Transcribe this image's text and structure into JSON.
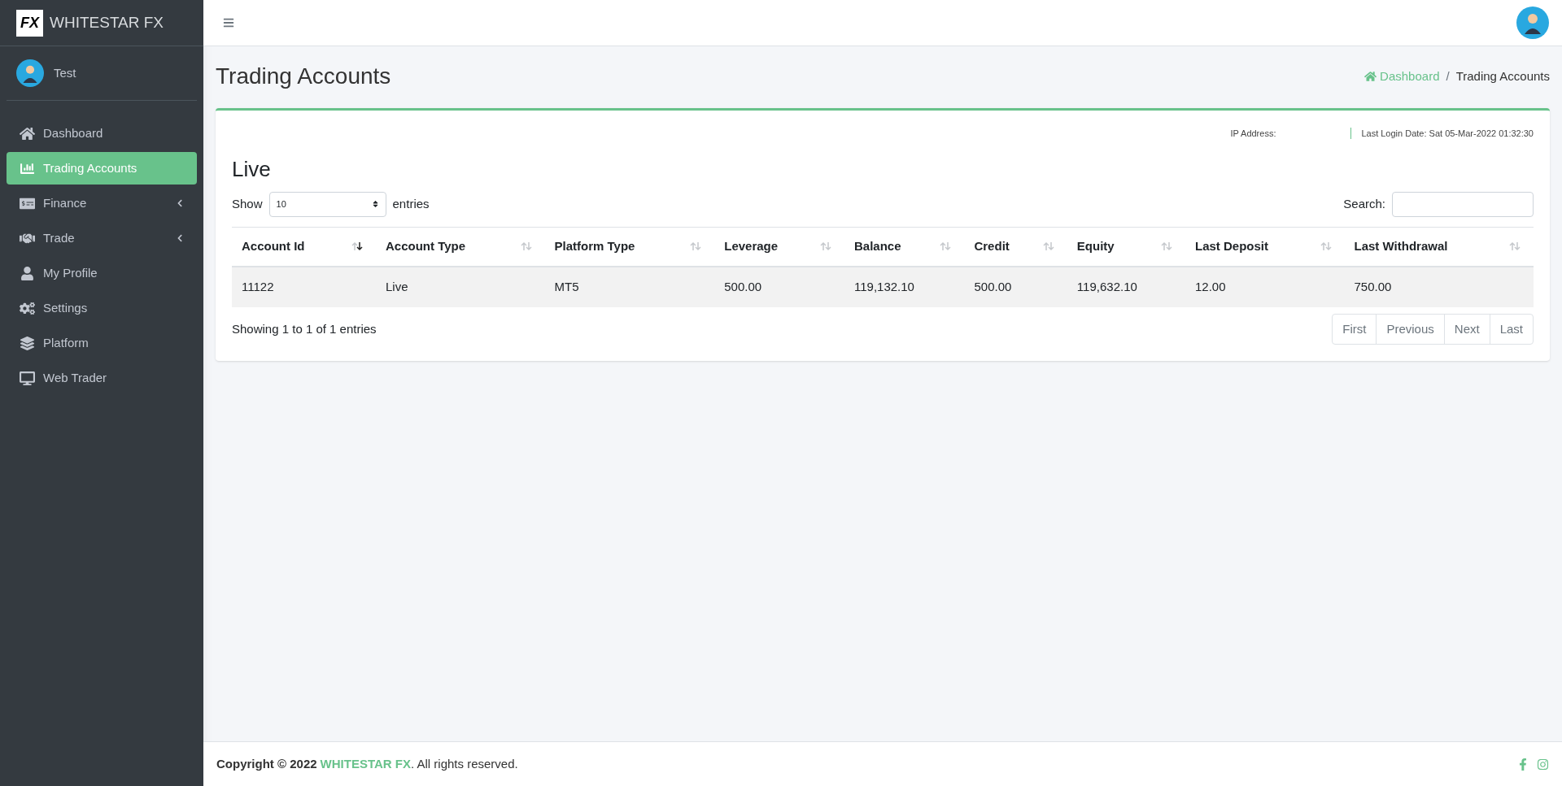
{
  "brand": {
    "logo": "FX",
    "name": "WHITESTAR FX"
  },
  "user": {
    "name": "Test"
  },
  "sidebar": {
    "items": [
      {
        "label": "Dashboard",
        "selected": false,
        "submenu": false
      },
      {
        "label": "Trading Accounts",
        "selected": true,
        "submenu": false
      },
      {
        "label": "Finance",
        "selected": false,
        "submenu": true
      },
      {
        "label": "Trade",
        "selected": false,
        "submenu": true
      },
      {
        "label": "My Profile",
        "selected": false,
        "submenu": false
      },
      {
        "label": "Settings",
        "selected": false,
        "submenu": false
      },
      {
        "label": "Platform",
        "selected": false,
        "submenu": false
      },
      {
        "label": "Web Trader",
        "selected": false,
        "submenu": false
      }
    ]
  },
  "page": {
    "title": "Trading Accounts",
    "breadcrumb": [
      "Dashboard",
      "Trading Accounts"
    ],
    "breadcrumb_separator": "/"
  },
  "card": {
    "ip_label": "IP Address:",
    "last_login": "Last Login Date: Sat 05-Mar-2022 01:32:30",
    "heading": "Live",
    "show_label": "Show",
    "page_size": "10",
    "entries_label": "entries",
    "search_label": "Search:",
    "columns": [
      {
        "label": "Account Id",
        "sorted": true
      },
      {
        "label": "Account Type",
        "sorted": false
      },
      {
        "label": "Platform Type",
        "sorted": false
      },
      {
        "label": "Leverage",
        "sorted": false
      },
      {
        "label": "Balance",
        "sorted": false
      },
      {
        "label": "Credit",
        "sorted": false
      },
      {
        "label": "Equity",
        "sorted": false
      },
      {
        "label": "Last Deposit",
        "sorted": false
      },
      {
        "label": "Last Withdrawal",
        "sorted": false
      }
    ],
    "rows": [
      [
        "11122",
        "Live",
        "MT5",
        "500.00",
        "119,132.10",
        "500.00",
        "119,632.10",
        "12.00",
        "750.00"
      ]
    ],
    "info": "Showing 1 to 1 of 1 entries",
    "pagination": [
      "First",
      "Previous",
      "Next",
      "Last"
    ]
  },
  "footer": {
    "prefix": "Copyright © 2022",
    "brand": "WHITESTAR FX",
    "suffix": ". All rights reserved."
  }
}
